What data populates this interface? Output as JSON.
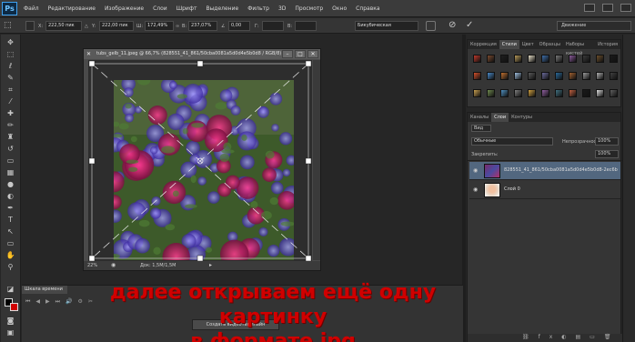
{
  "app": {
    "logo": "Ps",
    "menu": [
      "Файл",
      "Редактирование",
      "Изображение",
      "Слои",
      "Шрифт",
      "Выделение",
      "Фильтр",
      "3D",
      "Просмотр",
      "Окно",
      "Справка"
    ]
  },
  "options_bar": {
    "x_value": "222,50 пик",
    "y_value": "222,00 пик",
    "w_value": "172,49%",
    "h_value": "237,07%",
    "angle_value": "0,00",
    "interp_value": "Бикубическая",
    "workspace": "Движение"
  },
  "document": {
    "title": "tubs_gelb_11.jpeg @ 66,7% (828551_41_861/50cba0081a5d0d4e5b0d8 / RGB/8)",
    "zoom": "22%",
    "status": "Док: 1,5М/1,5М"
  },
  "swatches_panel": {
    "tabs": [
      "Коррекция",
      "Стили",
      "Цвет",
      "Образцы",
      "Наборы кистей",
      "История"
    ],
    "active_tab": "Стили",
    "colors": [
      "#c0392b",
      "#7b4a2e",
      "#1f1f1f",
      "#b89a5a",
      "#e8e0c8",
      "#3e6ea8",
      "#7a7a7a",
      "#8a5a9a",
      "#3a3a3a",
      "#6b4e2a",
      "#1a1a1a",
      "#d4502a",
      "#4a8ac8",
      "#c07030",
      "#a0c0e0",
      "#5a5a5a",
      "#6a6a9a",
      "#2a6a9a",
      "#a06030",
      "#9a9a9a",
      "#b0b0b0",
      "#404040",
      "#c8a050",
      "#708a50",
      "#5090c0",
      "#808080",
      "#d0a040",
      "#9060a0",
      "#407080",
      "#c06040",
      "#1a1a1a",
      "#e0e0e0",
      "#606060"
    ]
  },
  "layers_panel": {
    "tabs": [
      "Каналы",
      "Слои",
      "Контуры"
    ],
    "active_tab": "Слои",
    "kind_filter": "Вид",
    "blend_mode": "Обычные",
    "opacity_label": "Непрозрачность:",
    "opacity_value": "100%",
    "lock_label": "Закрепить:",
    "fill_value": "100%",
    "layers": [
      {
        "name": "828551_41_861/50cba0081a5d0d4e5b0d8-2ec6b",
        "visible": true,
        "selected": true
      },
      {
        "name": "Слой 0",
        "visible": true,
        "selected": false
      }
    ]
  },
  "timeline": {
    "tab": "Шкала времени",
    "create_button": "Создать видеотаймлайн"
  },
  "caption": {
    "line1": "далее открываем ещё одну картинку",
    "line2": "в формате jpg"
  }
}
